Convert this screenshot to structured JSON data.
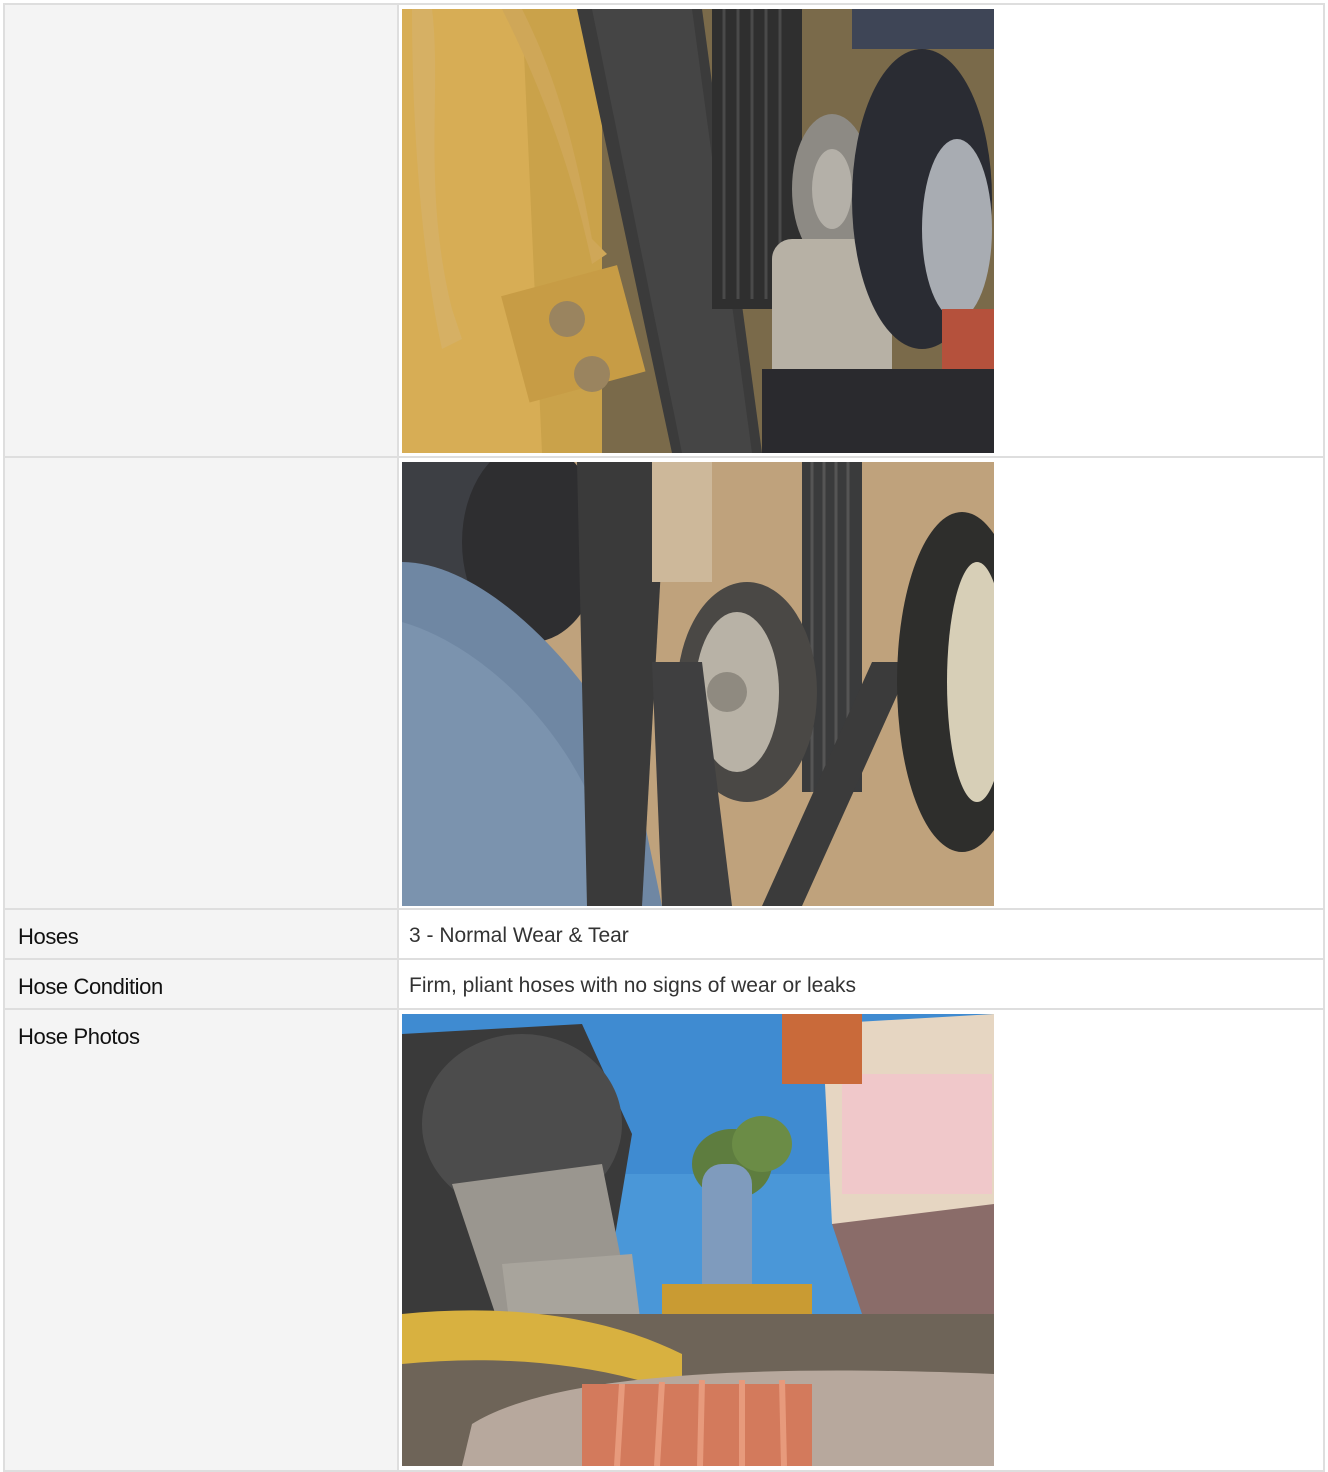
{
  "rows": [
    {
      "label": "",
      "type": "photo",
      "photo": "engine-belt-photo-1"
    },
    {
      "label": "",
      "type": "photo",
      "photo": "engine-belt-photo-2"
    },
    {
      "label": "Hoses",
      "type": "text",
      "value": "3 - Normal Wear & Tear"
    },
    {
      "label": "Hose Condition",
      "type": "text",
      "value": "Firm, pliant hoses with no signs of wear or leaks"
    },
    {
      "label": "Hose Photos",
      "type": "photo",
      "photo": "engine-hose-photo"
    }
  ],
  "colors": {
    "label_bg": "#f4f4f4",
    "border": "#dedede",
    "text": "#333333"
  }
}
